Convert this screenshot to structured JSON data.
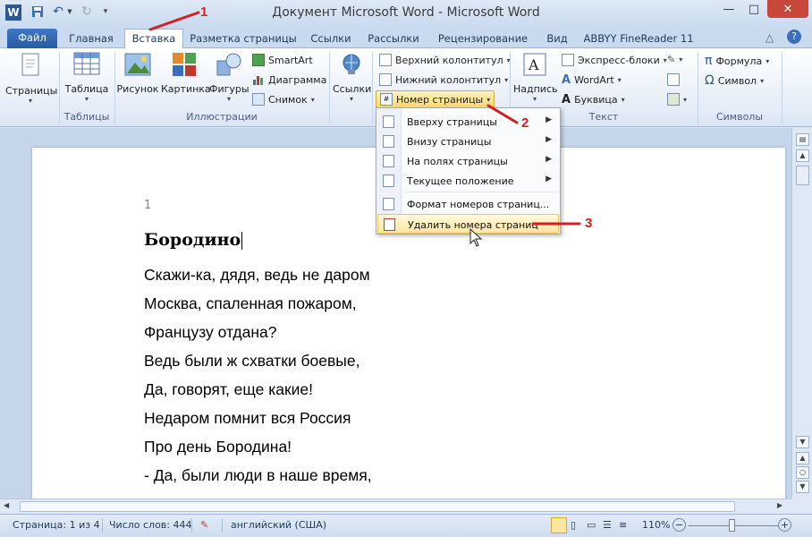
{
  "window": {
    "title": "Документ Microsoft Word  -  Microsoft Word",
    "controls": [
      "—",
      "□",
      "✕"
    ]
  },
  "tabs": [
    {
      "label": "Файл",
      "kind": "file"
    },
    {
      "label": "Главная"
    },
    {
      "label": "Вставка",
      "active": true
    },
    {
      "label": "Разметка страницы"
    },
    {
      "label": "Ссылки"
    },
    {
      "label": "Рассылки"
    },
    {
      "label": "Рецензирование"
    },
    {
      "label": "Вид"
    },
    {
      "label": "ABBYY FineReader 11"
    }
  ],
  "ribbon": {
    "pages": {
      "label": "Страницы"
    },
    "tables": {
      "button": "Таблица",
      "group": "Таблицы"
    },
    "illustrations": {
      "group": "Иллюстрации",
      "picture": "Рисунок",
      "clipart": "Картинка",
      "shapes": "Фигуры",
      "smartart": "SmartArt",
      "chart": "Диаграмма",
      "screenshot": "Снимок"
    },
    "links": {
      "label": "Ссылки"
    },
    "header_footer": {
      "header": "Верхний колонтитул",
      "footer": "Нижний колонтитул",
      "page_number": "Номер страницы"
    },
    "text": {
      "group": "Текст",
      "textbox": "Надпись",
      "quickparts": "Экспресс-блоки",
      "wordart": "WordArt",
      "dropcap": "Буквица"
    },
    "symbols": {
      "group": "Символы",
      "equation": "Формула",
      "symbol": "Символ"
    }
  },
  "dropdown": {
    "items": [
      {
        "label": "Вверху страницы",
        "submenu": true
      },
      {
        "label": "Внизу страницы",
        "submenu": true
      },
      {
        "label": "На полях страницы",
        "submenu": true
      },
      {
        "label": "Текущее положение",
        "submenu": true
      },
      {
        "label": "Формат номеров страниц..."
      },
      {
        "label": "Удалить номера страниц",
        "highlighted": true
      }
    ]
  },
  "document": {
    "page_number": "1",
    "title": "Бородино",
    "lines": [
      "Скажи-ка, дядя, ведь не даром",
      "Москва, спаленная пожаром,",
      "Французу отдана?",
      "Ведь были ж схватки боевые,",
      "Да, говорят, еще какие!",
      "Недаром помнит вся Россия",
      "Про день Бородина!",
      "- Да, были люди в наше время,"
    ]
  },
  "statusbar": {
    "page": "Страница: 1 из 4",
    "words": "Число слов: 444",
    "language": "английский (США)",
    "zoom": "110%"
  },
  "annotations": [
    "1",
    "2",
    "3"
  ],
  "colors": {
    "accent": "#2a5aa3",
    "highlight": "#ffd766",
    "annotation": "#d21f1f"
  }
}
